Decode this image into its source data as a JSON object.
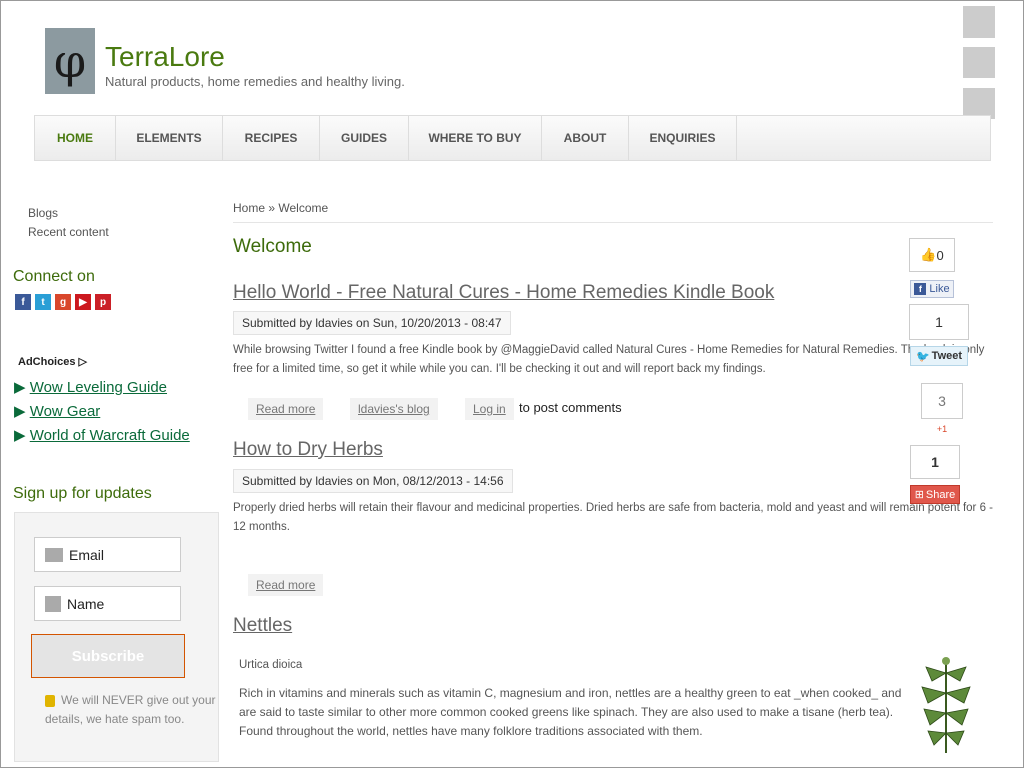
{
  "site": {
    "logo_glyph": "φ",
    "name": "TerraLore",
    "slogan": "Natural products, home remedies and healthy living."
  },
  "nav": [
    {
      "label": "HOME",
      "active": true
    },
    {
      "label": "ELEMENTS"
    },
    {
      "label": "RECIPES"
    },
    {
      "label": "GUIDES"
    },
    {
      "label": "WHERE TO BUY"
    },
    {
      "label": "ABOUT"
    },
    {
      "label": "ENQUIRIES"
    }
  ],
  "sidebar": {
    "links": [
      "Blogs",
      "Recent content"
    ],
    "connect_heading": "Connect on",
    "social_icons": [
      "facebook-icon",
      "twitter-icon",
      "google-plus-icon",
      "youtube-icon",
      "pinterest-icon"
    ],
    "adchoices": "AdChoices",
    "ad_links": [
      "Wow Leveling Guide",
      "Wow Gear",
      "World of Warcraft Guide"
    ],
    "signup_heading": "Sign up for updates",
    "email_placeholder": "Email",
    "name_placeholder": "Name",
    "subscribe_label": "Subscribe",
    "spam_note": "We will NEVER give out your details, we hate spam too."
  },
  "breadcrumb": {
    "home": "Home",
    "sep": "»",
    "current": "Welcome"
  },
  "page_title": "Welcome",
  "posts": [
    {
      "title": "Hello World - Free Natural Cures - Home Remedies Kindle Book",
      "submitted": "Submitted by ldavies on Sun, 10/20/2013 - 08:47",
      "body": "While browsing Twitter I found a free Kindle book by @MaggieDavid called Natural Cures - Home Remedies for Natural Remedies. The book is only free for a limited time, so get it while while you can. I'll be checking it out and will report back my findings.",
      "read_more": "Read more",
      "blog_link": "ldavies's blog",
      "login": "Log in",
      "post_comments": "to post comments"
    },
    {
      "title": "How to Dry Herbs",
      "submitted": "Submitted by ldavies on Mon, 08/12/2013 - 14:56",
      "body": "Properly dried herbs will retain their flavour and medicinal properties. Dried herbs are safe from bacteria, mold and yeast and will remain potent for 6 - 12 months.",
      "read_more": "Read more"
    },
    {
      "title": "Nettles",
      "subtitle": "Urtica dioica",
      "body": "Rich in vitamins and minerals such as vitamin C, magnesium and iron, nettles are a healthy green to eat _when cooked_ and are said to taste similar to other more common cooked greens like spinach. They are also used to make a tisane (herb tea). Found throughout the world, nettles have many folklore traditions associated with them."
    }
  ],
  "share": {
    "like_count": "0",
    "like_label": "Like",
    "tweet_count": "1",
    "tweet_label": "Tweet",
    "gplus_count": "3",
    "gplus_label": "+1",
    "share_count": "1",
    "share_label": "Share"
  }
}
